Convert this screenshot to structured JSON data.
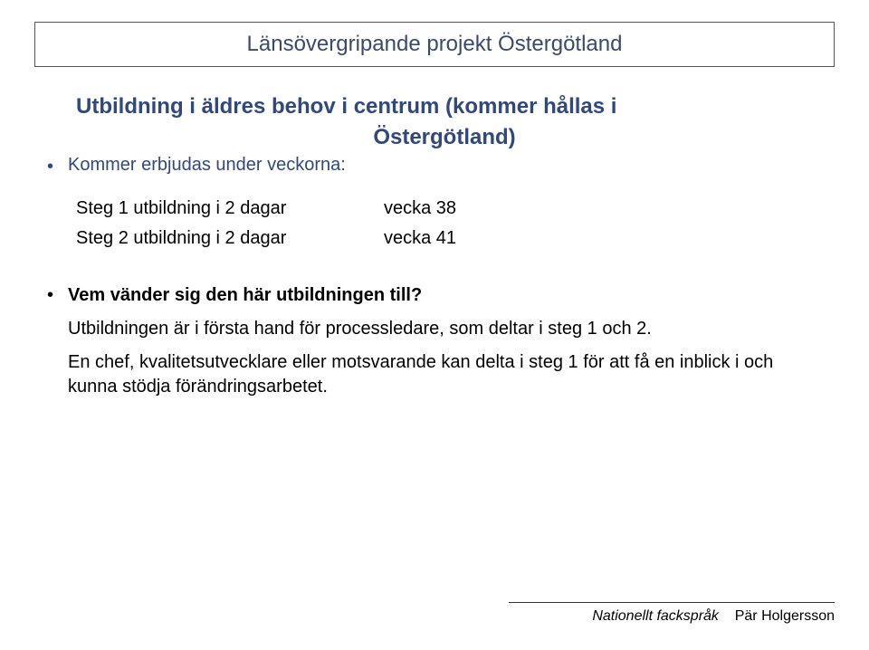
{
  "title": "Länsövergripande projekt Östergötland",
  "heading_line1": "Utbildning i äldres behov i centrum (kommer hållas i",
  "heading_line2": "Östergötland)",
  "subheading": "Kommer erbjudas under veckorna:",
  "table": {
    "rows": [
      {
        "left": "Steg 1 utbildning i 2 dagar",
        "right": "vecka 38"
      },
      {
        "left": "Steg 2 utbildning i 2 dagar",
        "right": "vecka 41"
      }
    ]
  },
  "qa": {
    "question": "Vem vänder sig den här utbildningen till?",
    "answer1": "Utbildningen är i första hand för processledare, som deltar i steg 1 och 2.",
    "answer2": "En chef, kvalitetsutvecklare eller motsvarande kan delta i steg 1 för att få en inblick i och kunna stödja förändringsarbetet."
  },
  "footer": {
    "italic": "Nationellt fackspråk",
    "author": "Pär Holgersson"
  }
}
